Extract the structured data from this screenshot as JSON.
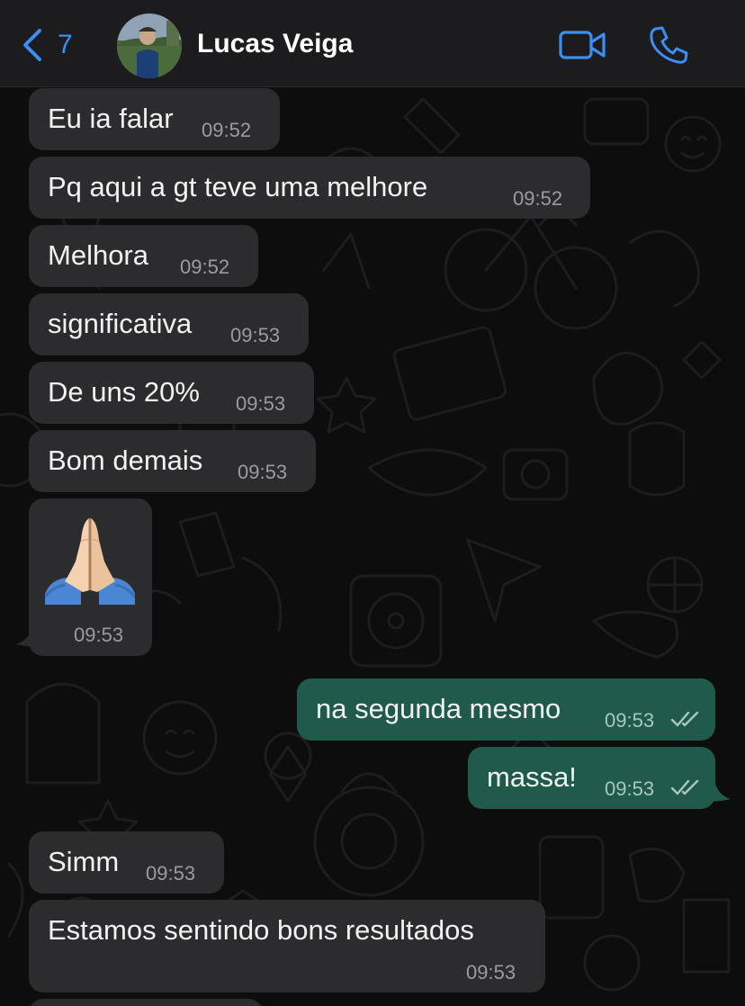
{
  "header": {
    "back_count": "7",
    "contact_name": "Lucas Veiga",
    "back_icon": "chevron-left-icon",
    "video_icon": "video-camera-icon",
    "call_icon": "phone-icon",
    "accent_color": "#3b8ef5"
  },
  "messages": [
    {
      "direction": "in",
      "text": "Eu ia falar",
      "time": "09:52"
    },
    {
      "direction": "in",
      "text": "Pq aqui a gt teve uma melhore",
      "time": "09:52"
    },
    {
      "direction": "in",
      "text": "Melhora",
      "time": "09:52"
    },
    {
      "direction": "in",
      "text": "significativa",
      "time": "09:53"
    },
    {
      "direction": "in",
      "text": "De uns 20%",
      "time": "09:53"
    },
    {
      "direction": "in",
      "text": "Bom demais",
      "time": "09:53"
    },
    {
      "direction": "in",
      "emoji": "praying-hands-emoji",
      "time": "09:53"
    },
    {
      "direction": "out",
      "text": "na segunda mesmo",
      "time": "09:53",
      "status": "read"
    },
    {
      "direction": "out",
      "text": "massa!",
      "time": "09:53",
      "status": "read"
    },
    {
      "direction": "in",
      "text": "Simm",
      "time": "09:53"
    },
    {
      "direction": "in",
      "text": "Estamos sentindo bons resultados",
      "time": "09:53"
    }
  ],
  "colors": {
    "incoming_bubble": "#2c2c2e",
    "outgoing_bubble": "#1f5a4b",
    "background": "#0d0d0d"
  }
}
